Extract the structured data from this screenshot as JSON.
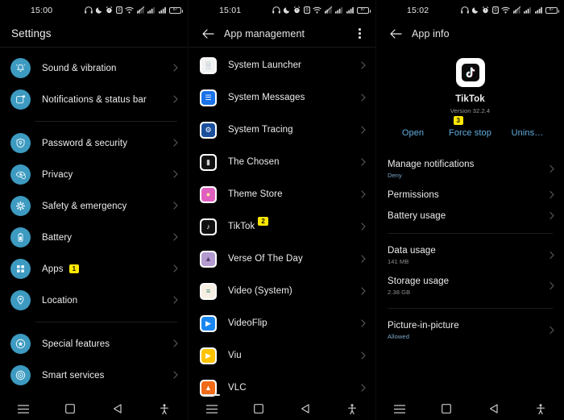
{
  "theme": {
    "background": "#000000",
    "accent_circle": "#3d9ac0",
    "badge_bg": "#ffe800",
    "badge_fg": "#111111",
    "link_blue": "#62aee0",
    "text_primary": "#efefef",
    "text_secondary": "#8e8e8e"
  },
  "panel1": {
    "status": {
      "time": "15:00",
      "battery_label": "87"
    },
    "title": "Settings",
    "items": [
      {
        "label": "Sound & vibration",
        "icon": "bell-icon",
        "badge": null,
        "divider_after": false
      },
      {
        "label": "Notifications & status bar",
        "icon": "notification-card-icon",
        "badge": null,
        "divider_after": true
      },
      {
        "label": "Password & security",
        "icon": "shield-key-icon",
        "badge": null,
        "divider_after": false
      },
      {
        "label": "Privacy",
        "icon": "privacy-eye-icon",
        "badge": null,
        "divider_after": false
      },
      {
        "label": "Safety & emergency",
        "icon": "safety-flower-icon",
        "badge": null,
        "divider_after": false
      },
      {
        "label": "Battery",
        "icon": "battery-icon",
        "badge": null,
        "divider_after": false
      },
      {
        "label": "Apps",
        "icon": "apps-grid-icon",
        "badge": "1",
        "divider_after": false
      },
      {
        "label": "Location",
        "icon": "location-pin-icon",
        "badge": null,
        "divider_after": true
      },
      {
        "label": "Special features",
        "icon": "special-features-icon",
        "badge": null,
        "divider_after": false
      },
      {
        "label": "Smart services",
        "icon": "smart-services-icon",
        "badge": null,
        "divider_after": false
      }
    ]
  },
  "panel2": {
    "status": {
      "time": "15:01",
      "battery_label": "87"
    },
    "title": "App management",
    "back_icon": "back-arrow-icon",
    "menu_icon": "overflow-menu-icon",
    "apps": [
      {
        "label": "System Launcher",
        "icon": "system-launcher-icon",
        "glyph": "▒",
        "bg": "#f2f2f2",
        "fg": "#9fb7c9",
        "badge": null
      },
      {
        "label": "System Messages",
        "icon": "system-messages-icon",
        "glyph": "☰",
        "bg": "#1a73e8",
        "fg": "#ffffff",
        "badge": null
      },
      {
        "label": "System Tracing",
        "icon": "system-tracing-icon",
        "glyph": "⚙",
        "bg": "#1b4f9c",
        "fg": "#ffffff",
        "badge": null
      },
      {
        "label": "The Chosen",
        "icon": "the-chosen-icon",
        "glyph": "▮",
        "bg": "#111111",
        "fg": "#cccccc",
        "badge": null
      },
      {
        "label": "Theme Store",
        "icon": "theme-store-icon",
        "glyph": "●",
        "bg": "#e060c0",
        "fg": "#ffe9a0",
        "badge": null
      },
      {
        "label": "TikTok",
        "icon": "tiktok-icon",
        "glyph": "♪",
        "bg": "#0f0f0f",
        "fg": "#ffffff",
        "badge": "2"
      },
      {
        "label": "Verse Of The Day",
        "icon": "verse-of-the-day-icon",
        "glyph": "▲",
        "bg": "#b39ad0",
        "fg": "#5b4070",
        "badge": null
      },
      {
        "label": "Video (System)",
        "icon": "video-system-icon",
        "glyph": "≡",
        "bg": "#f6efe2",
        "fg": "#3f8f7f",
        "badge": null
      },
      {
        "label": "VideoFlip",
        "icon": "videoflip-icon",
        "glyph": "▶",
        "bg": "#1a86f0",
        "fg": "#ffffff",
        "badge": null
      },
      {
        "label": "Viu",
        "icon": "viu-icon",
        "glyph": "▶",
        "bg": "#ffc300",
        "fg": "#ffffff",
        "badge": null
      },
      {
        "label": "VLC",
        "icon": "vlc-icon",
        "glyph": "▲",
        "bg": "#f06a18",
        "fg": "#ffffff",
        "badge": null
      }
    ]
  },
  "panel3": {
    "status": {
      "time": "15:02",
      "battery_label": "87"
    },
    "title": "App info",
    "back_icon": "back-arrow-icon",
    "app": {
      "name": "TikTok",
      "version": "Version 32.2.4",
      "icon": "tiktok-icon"
    },
    "actions": [
      {
        "label": "Open",
        "badge": null
      },
      {
        "label": "Force stop",
        "badge": "3"
      },
      {
        "label": "Unins…",
        "badge": null
      }
    ],
    "rows": [
      {
        "title": "Manage notifications",
        "sub": "Deny",
        "sub_style": "link",
        "divider_after": false
      },
      {
        "title": "Permissions",
        "sub": null,
        "sub_style": null,
        "divider_after": false
      },
      {
        "title": "Battery usage",
        "sub": null,
        "sub_style": null,
        "divider_after": true
      },
      {
        "title": "Data usage",
        "sub": "141 MB",
        "sub_style": "grey",
        "divider_after": false
      },
      {
        "title": "Storage usage",
        "sub": "2.38 GB",
        "sub_style": "grey",
        "divider_after": true
      },
      {
        "title": "Picture-in-picture",
        "sub": "Allowed",
        "sub_style": "link",
        "divider_after": false
      }
    ]
  },
  "navbar": {
    "items": [
      {
        "icon": "recents-menu-icon"
      },
      {
        "icon": "home-square-icon"
      },
      {
        "icon": "back-triangle-icon"
      },
      {
        "icon": "accessibility-icon"
      }
    ]
  }
}
